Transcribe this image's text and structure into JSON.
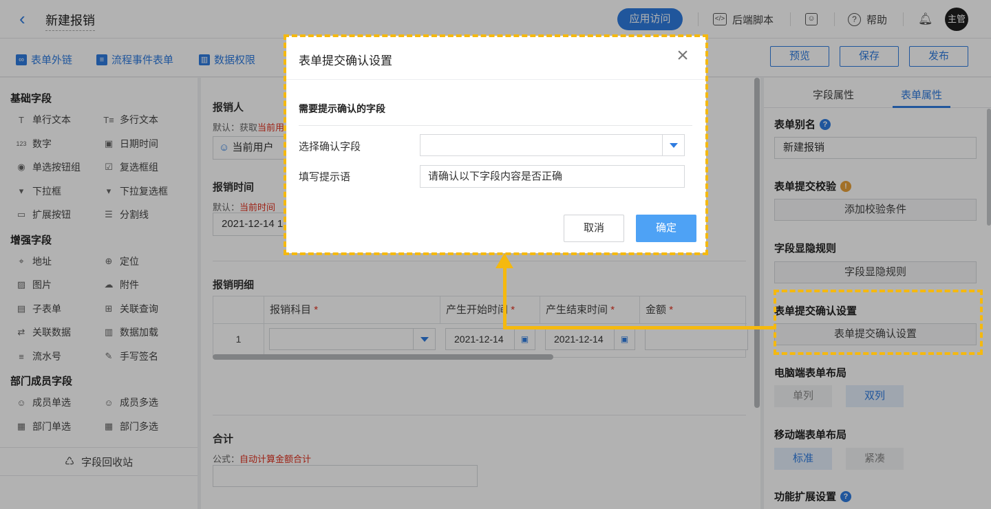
{
  "header": {
    "title": "新建报销",
    "app_visit": "应用访问",
    "backend_script": "后端脚本",
    "help": "帮助",
    "avatar": "主管"
  },
  "toolbar": {
    "form_link": "表单外链",
    "process_event_form": "流程事件表单",
    "data_permission": "数据权限",
    "preview": "预览",
    "save": "保存",
    "publish": "发布"
  },
  "left_panel": {
    "groups": [
      {
        "title": "基础字段",
        "items": [
          {
            "label": "单行文本",
            "icon": "T"
          },
          {
            "label": "多行文本",
            "icon": "T≡"
          },
          {
            "label": "数字",
            "icon": "123"
          },
          {
            "label": "日期时间",
            "icon": "▣"
          },
          {
            "label": "单选按钮组",
            "icon": "◉"
          },
          {
            "label": "复选框组",
            "icon": "☑"
          },
          {
            "label": "下拉框",
            "icon": "▾"
          },
          {
            "label": "下拉复选框",
            "icon": "▾"
          },
          {
            "label": "扩展按钮",
            "icon": "▭"
          },
          {
            "label": "分割线",
            "icon": "☰"
          }
        ]
      },
      {
        "title": "增强字段",
        "items": [
          {
            "label": "地址",
            "icon": "⌖"
          },
          {
            "label": "定位",
            "icon": "⊕"
          },
          {
            "label": "图片",
            "icon": "▨"
          },
          {
            "label": "附件",
            "icon": "☁"
          },
          {
            "label": "子表单",
            "icon": "▤"
          },
          {
            "label": "关联查询",
            "icon": "⊞"
          },
          {
            "label": "关联数据",
            "icon": "⇄"
          },
          {
            "label": "数据加载",
            "icon": "▥"
          },
          {
            "label": "流水号",
            "icon": "≡"
          },
          {
            "label": "手写签名",
            "icon": "✎"
          }
        ]
      },
      {
        "title": "部门成员字段",
        "items": [
          {
            "label": "成员单选",
            "icon": "☺"
          },
          {
            "label": "成员多选",
            "icon": "☺"
          },
          {
            "label": "部门单选",
            "icon": "▦"
          },
          {
            "label": "部门多选",
            "icon": "▦"
          }
        ]
      }
    ],
    "recycle": "字段回收站"
  },
  "form": {
    "reporter_label": "报销人",
    "reporter_hint_prefix": "默认：获取",
    "reporter_hint_red": "当前用",
    "reporter_value": "当前用户",
    "time_label": "报销时间",
    "time_hint_prefix": "默认：",
    "time_hint_red": "当前时间",
    "time_value": "2021-12-14 1",
    "detail_label": "报销明细",
    "columns": [
      "报销科目",
      "产生开始时间",
      "产生结束时间",
      "金额"
    ],
    "row_index": "1",
    "start_date": "2021-12-14",
    "end_date": "2021-12-14",
    "total_label": "合计",
    "total_hint_prefix": "公式：",
    "total_hint_red": "自动计算金额合计"
  },
  "right_panel": {
    "tab_field": "字段属性",
    "tab_form": "表单属性",
    "alias_label": "表单别名",
    "alias_value": "新建报销",
    "validate_label": "表单提交校验",
    "validate_button": "添加校验条件",
    "visibility_label": "字段显隐规则",
    "visibility_button": "字段显隐规则",
    "confirm_label": "表单提交确认设置",
    "confirm_button": "表单提交确认设置",
    "pc_layout_label": "电脑端表单布局",
    "pc_single": "单列",
    "pc_double": "双列",
    "mobile_layout_label": "移动端表单布局",
    "mobile_standard": "标准",
    "mobile_compact": "紧凑",
    "ext_label": "功能扩展设置"
  },
  "modal": {
    "title": "表单提交确认设置",
    "close": "×",
    "section": "需要提示确认的字段",
    "select_label": "选择确认字段",
    "select_value": "",
    "prompt_label": "填写提示语",
    "prompt_value": "请确认以下字段内容是否正确",
    "cancel": "取消",
    "ok": "确定"
  },
  "colors": {
    "accent": "#2f7ce0",
    "callout": "#f5b90f",
    "required": "#e0301e"
  }
}
